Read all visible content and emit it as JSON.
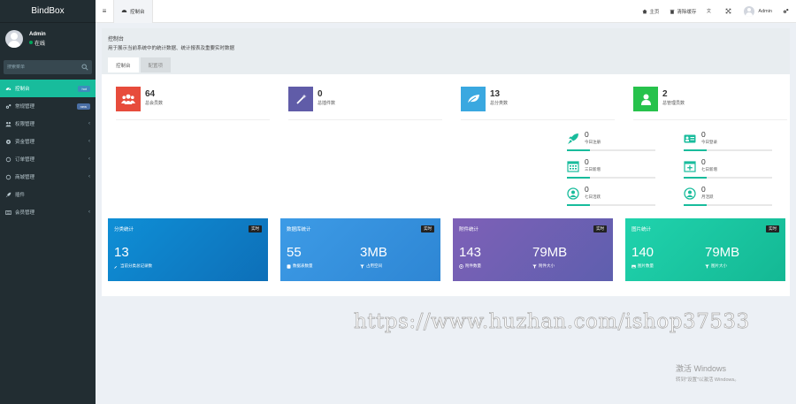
{
  "app": {
    "title": "BindBox"
  },
  "user": {
    "name": "Admin",
    "status": "在线"
  },
  "search": {
    "placeholder": "搜索菜单"
  },
  "sidebar": {
    "items": [
      {
        "label": "控制台",
        "icon": "dashboard-icon",
        "badge": "hot",
        "active": true
      },
      {
        "label": "常规管理",
        "icon": "cogs-icon",
        "badge": "new"
      },
      {
        "label": "权限管理",
        "icon": "group-icon",
        "chevron": "‹"
      },
      {
        "label": "资金管理",
        "icon": "gear-icon",
        "chevron": "‹"
      },
      {
        "label": "订单管理",
        "icon": "circle-icon",
        "chevron": "‹"
      },
      {
        "label": "商城管理",
        "icon": "circle-icon",
        "chevron": "‹"
      },
      {
        "label": "插件",
        "icon": "rocket-icon"
      },
      {
        "label": "会员管理",
        "icon": "list-icon",
        "chevron": "‹"
      }
    ]
  },
  "topbar": {
    "tab": "控制台",
    "home": "主页",
    "clear_cache": "清除缓存",
    "user": "Admin"
  },
  "panel": {
    "title": "控制台",
    "description": "用于展示当前系统中的统计数据、统计报表及重要实时数据",
    "tabs": [
      "控制台",
      "配置项"
    ]
  },
  "stats": [
    {
      "value": "64",
      "label": "总会员数",
      "color": "#e74c3c",
      "icon": "users-icon"
    },
    {
      "value": "0",
      "label": "总插件数",
      "color": "#605ca8",
      "icon": "magic-icon"
    },
    {
      "value": "13",
      "label": "总分类数",
      "color": "#3aa8e0",
      "icon": "leaf-icon"
    },
    {
      "value": "2",
      "label": "总管理员数",
      "color": "#27c24c",
      "icon": "user-icon"
    }
  ],
  "mini_stats": [
    {
      "value": "0",
      "label": "今日注册",
      "icon": "rocket-icon"
    },
    {
      "value": "0",
      "label": "今日登录",
      "icon": "vcard-icon"
    },
    {
      "value": "0",
      "label": "三日新增",
      "icon": "calendar-icon"
    },
    {
      "value": "0",
      "label": "七日新增",
      "icon": "calendar-plus-icon"
    },
    {
      "value": "0",
      "label": "七日活跃",
      "icon": "user-circle-icon"
    },
    {
      "value": "0",
      "label": "月活跃",
      "icon": "user-circle-icon"
    }
  ],
  "cards": [
    {
      "title": "分类统计",
      "tag": "实时",
      "color_from": "#0f8fd6",
      "color_to": "#0d6fb8",
      "cols": [
        {
          "value": "13",
          "label": "当前分类总记录数",
          "icon": "wrench-icon"
        }
      ]
    },
    {
      "title": "数据库统计",
      "tag": "实时",
      "color_from": "#3d9be6",
      "color_to": "#2e86d4",
      "cols": [
        {
          "value": "55",
          "label": "数据表数量",
          "icon": "database-icon"
        },
        {
          "value": "3MB",
          "label": "占用空间",
          "icon": "filter-icon"
        }
      ]
    },
    {
      "title": "附件统计",
      "tag": "实时",
      "color_from": "#7e60b7",
      "color_to": "#5e5fae",
      "cols": [
        {
          "value": "143",
          "label": "附件数量",
          "icon": "attachment-icon"
        },
        {
          "value": "79MB",
          "label": "附件大小",
          "icon": "filter-icon"
        }
      ]
    },
    {
      "title": "图片统计",
      "tag": "实时",
      "color_from": "#20d3ad",
      "color_to": "#14b894",
      "cols": [
        {
          "value": "140",
          "label": "图片数量",
          "icon": "image-icon"
        },
        {
          "value": "79MB",
          "label": "图片大小",
          "icon": "filter-icon"
        }
      ]
    }
  ],
  "watermark": "https://www.huzhan.com/ishop37533",
  "activation": {
    "title": "激活 Windows",
    "subtitle": "转到\"设置\"以激活 Windows。"
  }
}
